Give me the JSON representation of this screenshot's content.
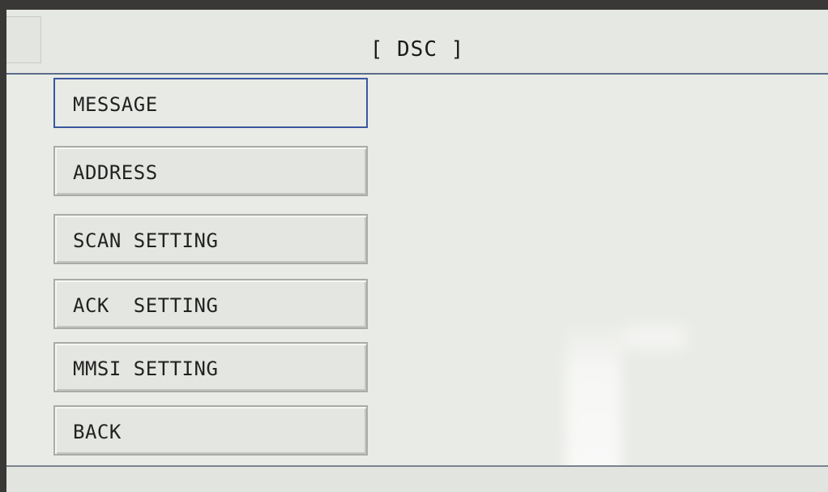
{
  "header": {
    "title": "[ DSC ]"
  },
  "menu": {
    "items": [
      {
        "label": "MESSAGE",
        "selected": true
      },
      {
        "label": "ADDRESS",
        "selected": false
      },
      {
        "label": "SCAN SETTING",
        "selected": false
      },
      {
        "label": "ACK  SETTING",
        "selected": false
      },
      {
        "label": "MMSI SETTING",
        "selected": false
      },
      {
        "label": "BACK",
        "selected": false
      }
    ]
  },
  "colors": {
    "selection_border": "#3b56a0",
    "screen_background": "#e9ebe6"
  }
}
